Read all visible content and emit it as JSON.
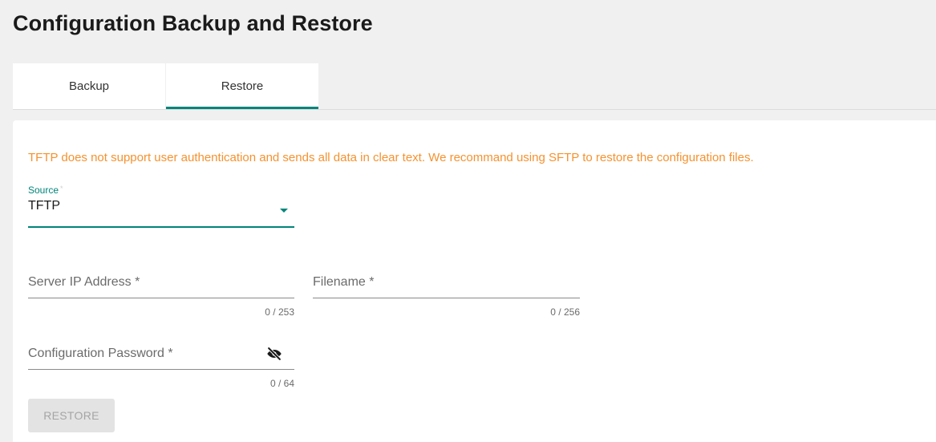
{
  "page": {
    "title": "Configuration Backup and Restore"
  },
  "tabs": [
    {
      "label": "Backup",
      "active": false
    },
    {
      "label": "Restore",
      "active": true
    }
  ],
  "restore": {
    "warning": "TFTP does not support user authentication and sends all data in clear text. We recommand using SFTP to restore the configuration files.",
    "source": {
      "label": "Source",
      "required_mark": "*",
      "value": "TFTP"
    },
    "server_ip": {
      "placeholder": "Server IP Address *",
      "value": "",
      "counter": "0 / 253"
    },
    "filename": {
      "placeholder": "Filename *",
      "value": "",
      "counter": "0 / 256"
    },
    "password": {
      "placeholder": "Configuration Password *",
      "value": "",
      "counter": "0 / 64",
      "toggle_icon": "eye-off-icon"
    },
    "button_label": "RESTORE"
  },
  "colors": {
    "accent": "#00857a",
    "warning": "#f5922f",
    "disabled_bg": "#e3e3e3",
    "disabled_text": "#a5a5a5"
  }
}
